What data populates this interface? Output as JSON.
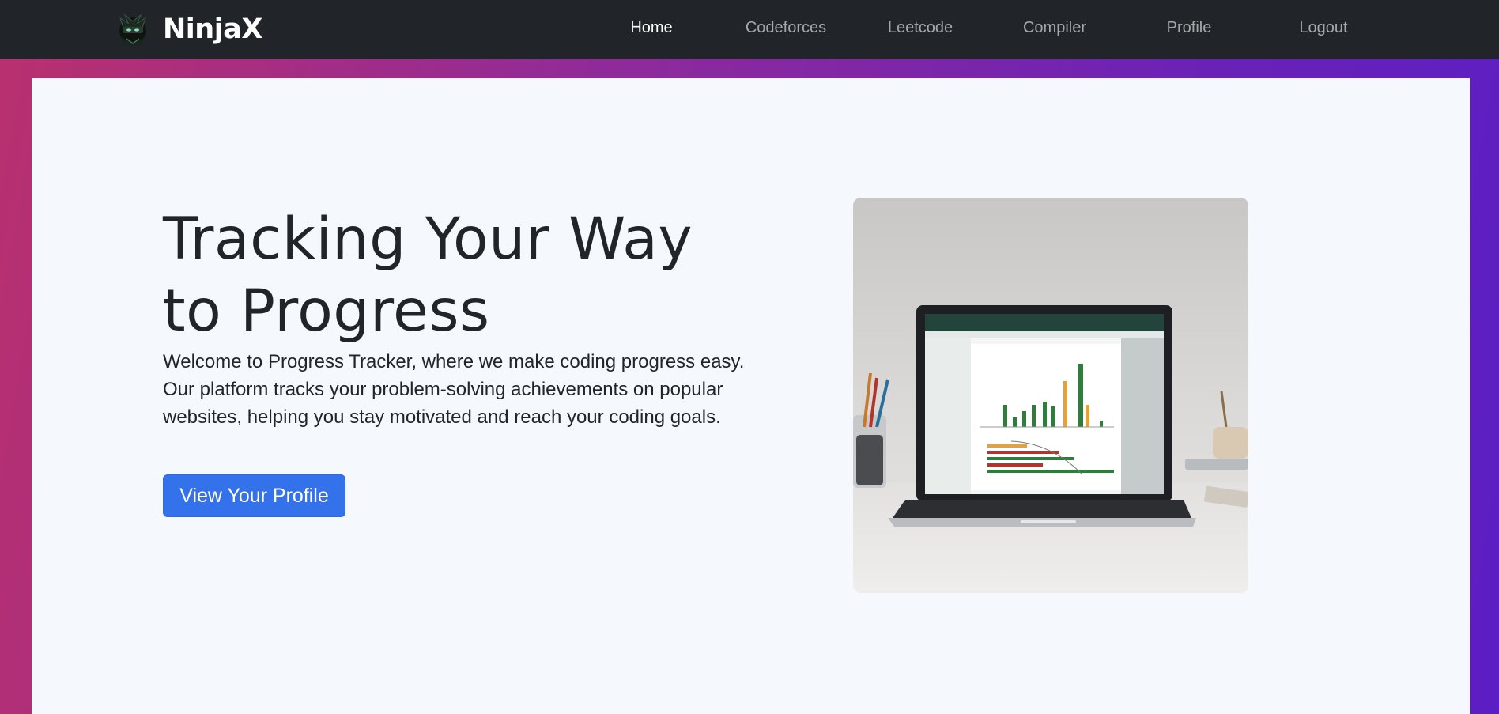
{
  "brand": {
    "name": "NinjaX",
    "logo_icon": "ninja-logo-icon"
  },
  "nav": {
    "items": [
      {
        "label": "Home",
        "active": true
      },
      {
        "label": "Codeforces",
        "active": false
      },
      {
        "label": "Leetcode",
        "active": false
      },
      {
        "label": "Compiler",
        "active": false
      },
      {
        "label": "Profile",
        "active": false
      },
      {
        "label": "Logout",
        "active": false
      }
    ]
  },
  "hero": {
    "title_line1": "Tracking Your Way",
    "title_line2": "to Progress",
    "description": "Welcome to Progress Tracker, where we make coding progress easy. Our platform tracks your problem-solving achievements on popular websites, helping you stay motivated and reach your coding goals.",
    "button_label": "View Your Profile",
    "image_icon": "laptop-progress-dashboard-image"
  },
  "colors": {
    "navbar": "#212529",
    "gradient_start": "#b9306e",
    "gradient_end": "#5b1ec4",
    "card": "#f5f8fc",
    "button": "#3472ec"
  }
}
